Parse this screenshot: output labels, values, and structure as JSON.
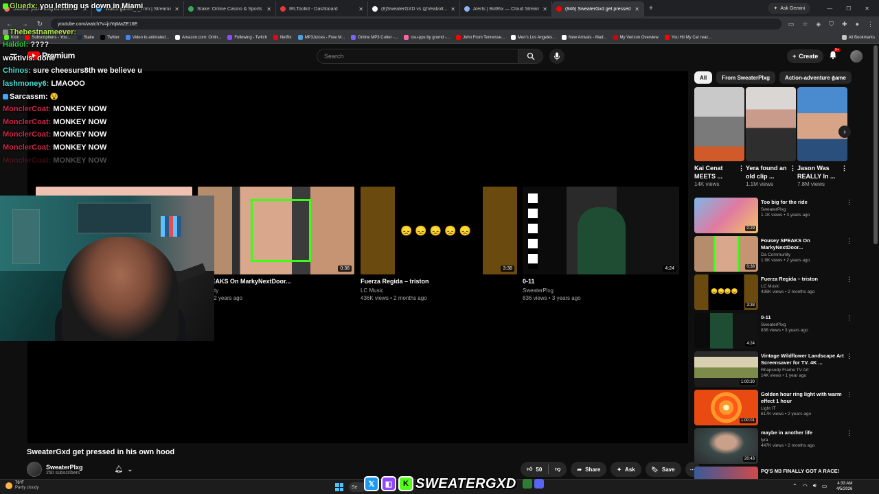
{
  "browser": {
    "tabs": [
      {
        "title": "Gluedx: you letting us down in Miami",
        "color": "#ff6b6b"
      },
      {
        "title": "Watch gamer_-_Trim | Streamable",
        "color": "#3ea6ff"
      },
      {
        "title": "Stake: Online Casino & Sports Betting",
        "color": "#3ba55c"
      },
      {
        "title": "IRLToolkit - Dashboard",
        "color": "#e53935"
      },
      {
        "title": "(8)SweaterGXD vs @Veabolt...",
        "color": "#ffffff"
      },
      {
        "title": "Alerts | BotRix — Cloud Stream",
        "color": "#8ab4f8"
      },
      {
        "title": "(946) SweaterGxd get pressed in",
        "color": "#ff0000"
      }
    ],
    "new_tab": "+",
    "gemini_label": "Ask Gemini",
    "url": "youtube.com/watch?v=joYqMaZE16E",
    "bookmarks": [
      "Kick",
      "Subscriptions - You...",
      "Stake",
      "Twitter",
      "Video to animated...",
      "Amazon.com: Onlin...",
      "Following - Twitch",
      "Netflix",
      "MP3Juices - Free M...",
      "Online MP3 Cutter -...",
      "osu-pps by grumd -...",
      "John From Tennesse...",
      "Men's Los Angeles...",
      "New Arrivals - Mad...",
      "My Verizon Overview",
      "You Hit My Car reac..."
    ],
    "all_bookmarks": "All Bookmarks"
  },
  "youtube": {
    "logo_text": "Premium",
    "search_placeholder": "Search",
    "create_label": "Create",
    "notif_badge": "9+",
    "video_title": "SweaterGxd get pressed in his own hood",
    "channel_name": "SweaterPlxg",
    "subscribers": "250 subscribers",
    "likes": "50",
    "share_label": "Share",
    "ask_label": "Ask",
    "save_label": "Save"
  },
  "endcards": [
    {
      "title": "y SPEAKS On MarkyNextDoor...",
      "channel": "mmunity",
      "meta": "iews • 2 years ago",
      "duration": "0:38"
    },
    {
      "title": "Fuerza Regida – triston",
      "channel": "LC Music",
      "meta": "436K views • 2 months ago",
      "duration": "3:38"
    },
    {
      "title": "0-11",
      "channel": "SweaterPlxg",
      "meta": "836 views • 3 years ago",
      "duration": "4:24"
    }
  ],
  "chat": [
    {
      "user": "Gluedx:",
      "msg": "you letting us down in Miami",
      "color": "#b5e853"
    },
    {
      "user": "Thebestnameever:",
      "msg": "",
      "color": "#b5e853"
    },
    {
      "user": "Haldol:",
      "msg": "????",
      "color": "#2ecc40"
    },
    {
      "user": "woktivis:",
      "msg": "done",
      "color": "#ffffff"
    },
    {
      "user": "Chinos:",
      "msg": "sure cheesurs8th we believe u",
      "color": "#4ee1d7"
    },
    {
      "user": "lashmoney6:",
      "msg": "LMAOOO",
      "color": "#4ee1d7"
    },
    {
      "user": "Sarcassm:",
      "msg": "",
      "color": "#ffffff"
    },
    {
      "user": "MonclerCoat:",
      "msg": "MONKEY NOW",
      "color": "#d22548"
    },
    {
      "user": "MonclerCoat:",
      "msg": "MONKEY NOW",
      "color": "#d22548"
    },
    {
      "user": "MonclerCoat:",
      "msg": "MONKEY NOW",
      "color": "#d22548"
    },
    {
      "user": "MonclerCoat:",
      "msg": "MONKEY NOW",
      "color": "#d22548"
    },
    {
      "user": "MonclerCoat:",
      "msg": "MONKEY NOW",
      "color": "#3a3a3a"
    }
  ],
  "sidebar": {
    "chips": [
      "All",
      "From SweaterPlxg",
      "Action-adventure game"
    ],
    "shorts": [
      {
        "title": "Kai Cenat MEETS ...",
        "views": "14K views"
      },
      {
        "title": "Yera found an old clip ...",
        "views": "1.1M views"
      },
      {
        "title": "Jason Was REALLY In ...",
        "views": "7.8M views"
      }
    ],
    "recs": [
      {
        "title": "Too big for the ride",
        "channel": "SweaterPlxg",
        "meta": "1.1K views • 3 years ago",
        "duration": "0:29"
      },
      {
        "title": "Fousey SPEAKS On MarkyNextDoor...",
        "channel": "Da Community",
        "meta": "1.9K views • 2 years ago",
        "duration": "0:38"
      },
      {
        "title": "Fuerza Regida – triston",
        "channel": "LC Music",
        "meta": "436K views • 2 months ago",
        "duration": "3:38"
      },
      {
        "title": "0-11",
        "channel": "SweaterPlxg",
        "meta": "836 views • 3 years ago",
        "duration": "4:24"
      },
      {
        "title": "Vintage Wildflower Landscape Art Screensaver for TV. 4K ...",
        "channel": "Rhapsody Frame TV Art",
        "meta": "14K views • 1 year ago",
        "duration": "1:00:30"
      },
      {
        "title": "Golden hour ring light with warm effect 1 hour",
        "channel": "Light IT",
        "meta": "617K views • 2 years ago",
        "duration": "1:00:01"
      },
      {
        "title": "maybe in another life",
        "channel": "lyra",
        "meta": "447K views • 2 months ago",
        "duration": "20:43"
      },
      {
        "title": "PQ'S M3 FINALLY GOT A RACE!",
        "channel": "",
        "meta": "",
        "duration": ""
      }
    ]
  },
  "taskbar": {
    "temp": "76°F",
    "weather": "Partly cloudy",
    "search": "Se",
    "brand": "SWEATERGXD",
    "time": "4:33 AM",
    "date": "4/5/2026"
  }
}
